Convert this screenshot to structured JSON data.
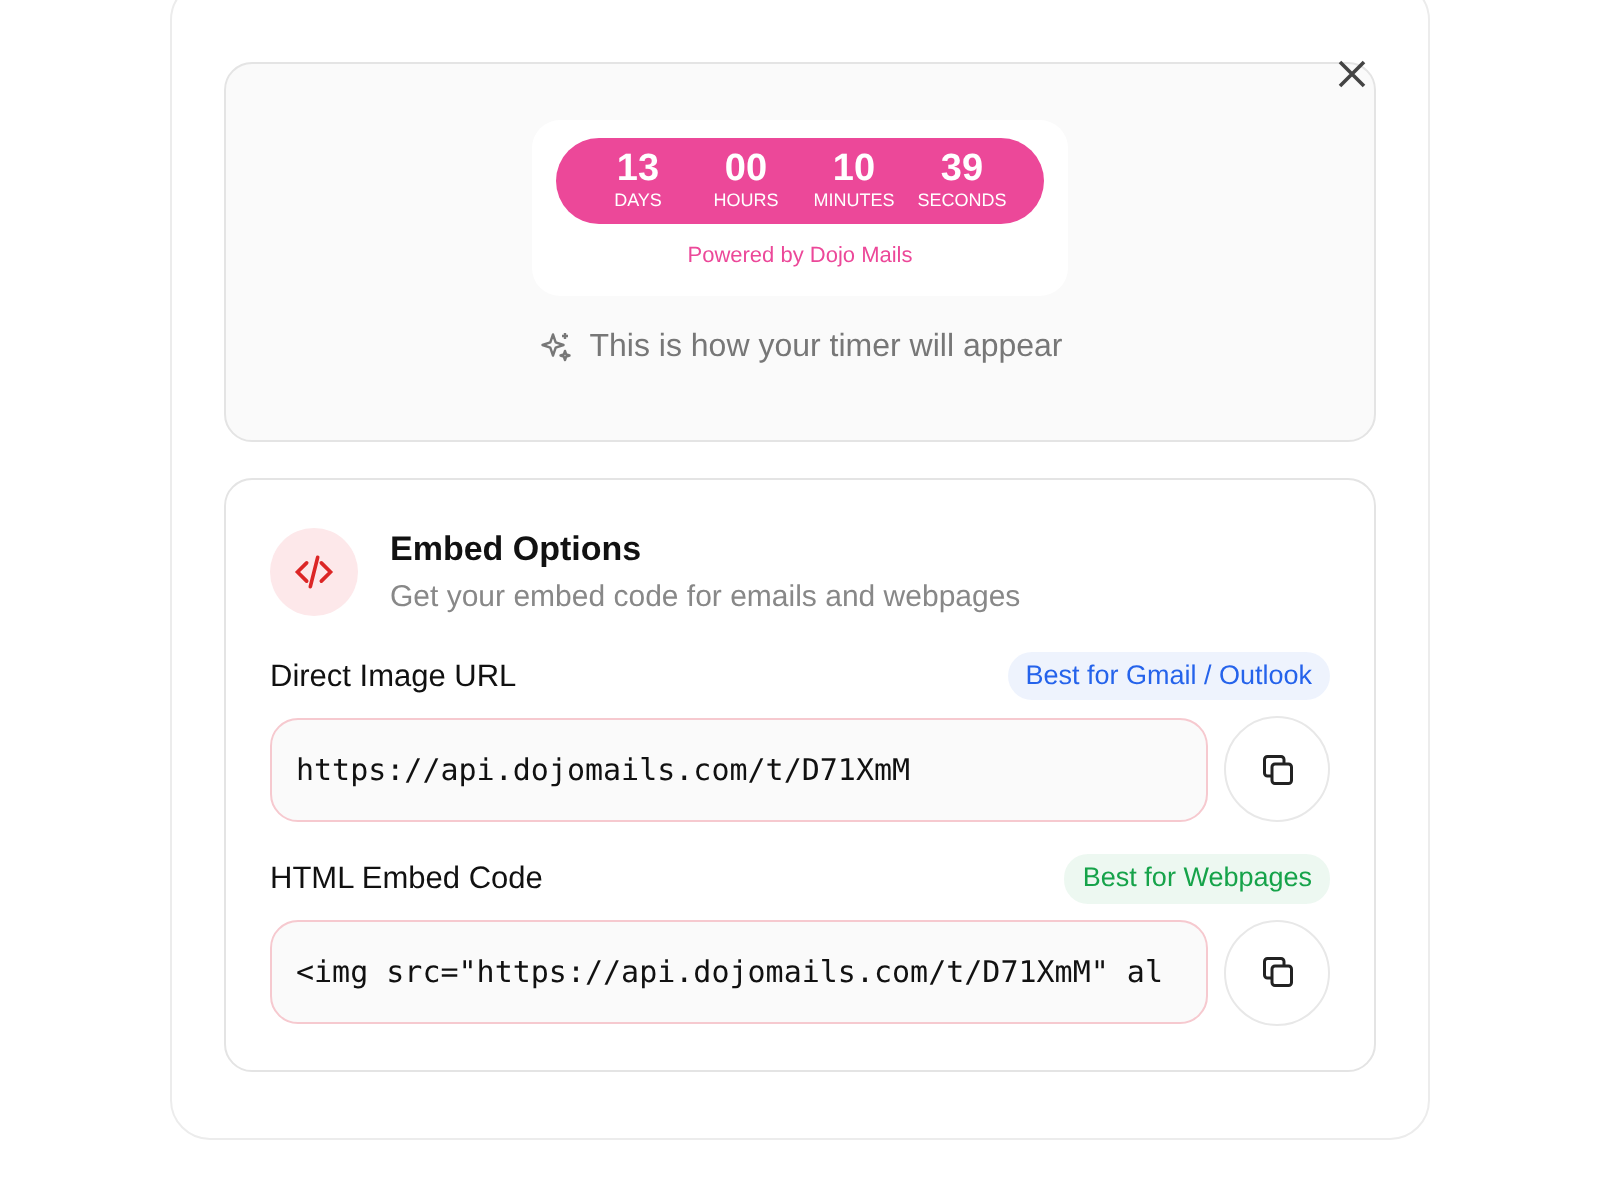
{
  "preview": {
    "timer": [
      {
        "value": "13",
        "unit": "DAYS"
      },
      {
        "value": "00",
        "unit": "HOURS"
      },
      {
        "value": "10",
        "unit": "MINUTES"
      },
      {
        "value": "39",
        "unit": "SECONDS"
      }
    ],
    "powered_by": "Powered by Dojo Mails",
    "caption": "This is how your timer will appear"
  },
  "embed": {
    "title": "Embed Options",
    "subtitle": "Get your embed code for emails and webpages",
    "options": [
      {
        "label": "Direct Image URL",
        "badge": "Best for Gmail / Outlook",
        "color": "#2563eb",
        "value": "https://api.dojomails.com/t/D71XmM"
      },
      {
        "label": "HTML Embed Code",
        "badge": "Best for Webpages",
        "color": "#16a34a",
        "value": "<img src=\"https://api.dojomails.com/t/D71XmM\" al"
      }
    ]
  }
}
